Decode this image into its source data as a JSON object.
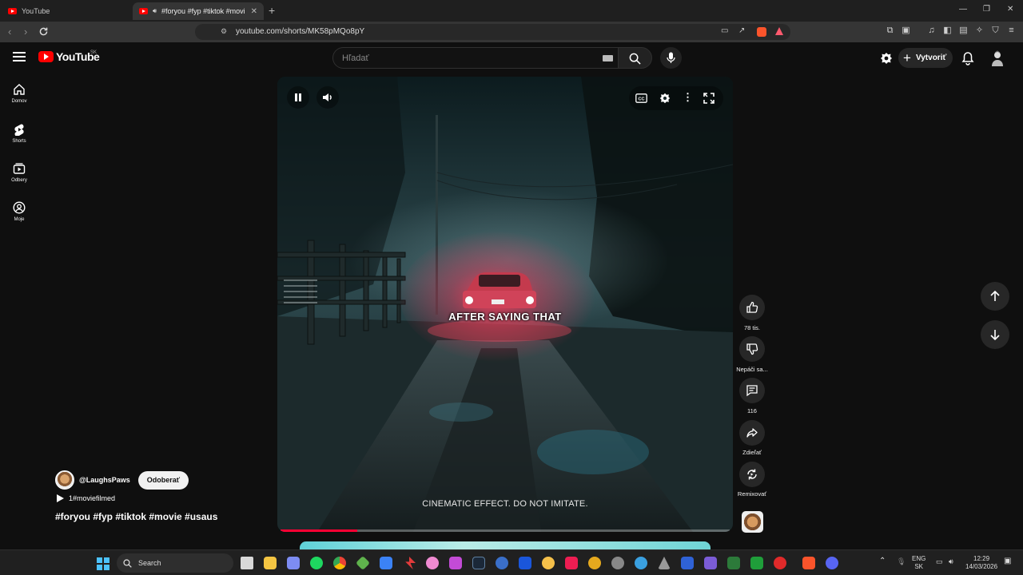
{
  "browser": {
    "tabs": [
      {
        "title": "YouTube",
        "active": false
      },
      {
        "title": "#foryou #fyp #tiktok #movie",
        "active": true
      }
    ],
    "url": "youtube.com/shorts/MK58pMQo8pY"
  },
  "header": {
    "logo_text": "YouTube",
    "region": "SK",
    "search_placeholder": "Hľadať",
    "create_label": "Vytvoriť"
  },
  "sidebar": {
    "items": [
      {
        "label": "Domov",
        "icon": "home-icon"
      },
      {
        "label": "Shorts",
        "icon": "shorts-icon"
      },
      {
        "label": "Odbery",
        "icon": "subscriptions-icon"
      },
      {
        "label": "Moje",
        "icon": "account-icon"
      }
    ]
  },
  "video": {
    "caption": "AFTER SAYING THAT",
    "disclaimer": "CINEMATIC EFFECT. DO NOT IMITATE.",
    "progress": 0.17,
    "channel": "@LaughsPaws",
    "subscribe_label": "Odoberať",
    "sound": "1#moviefilmed",
    "title": "#foryou #fyp #tiktok #movie #usaus"
  },
  "actions": {
    "like_count": "78 tis.",
    "dislike_label": "Nepáči sa...",
    "comment_count": "116",
    "share_label": "Zdieľať",
    "remix_label": "Remixovať"
  },
  "taskbar": {
    "search_label": "Search",
    "lang_primary": "ENG",
    "lang_secondary": "SK",
    "time": "12:29",
    "date": "14/03/2026"
  },
  "colors": {
    "accent": "#ff0000",
    "background": "#0f0f0f",
    "progress": "#ff0033"
  }
}
